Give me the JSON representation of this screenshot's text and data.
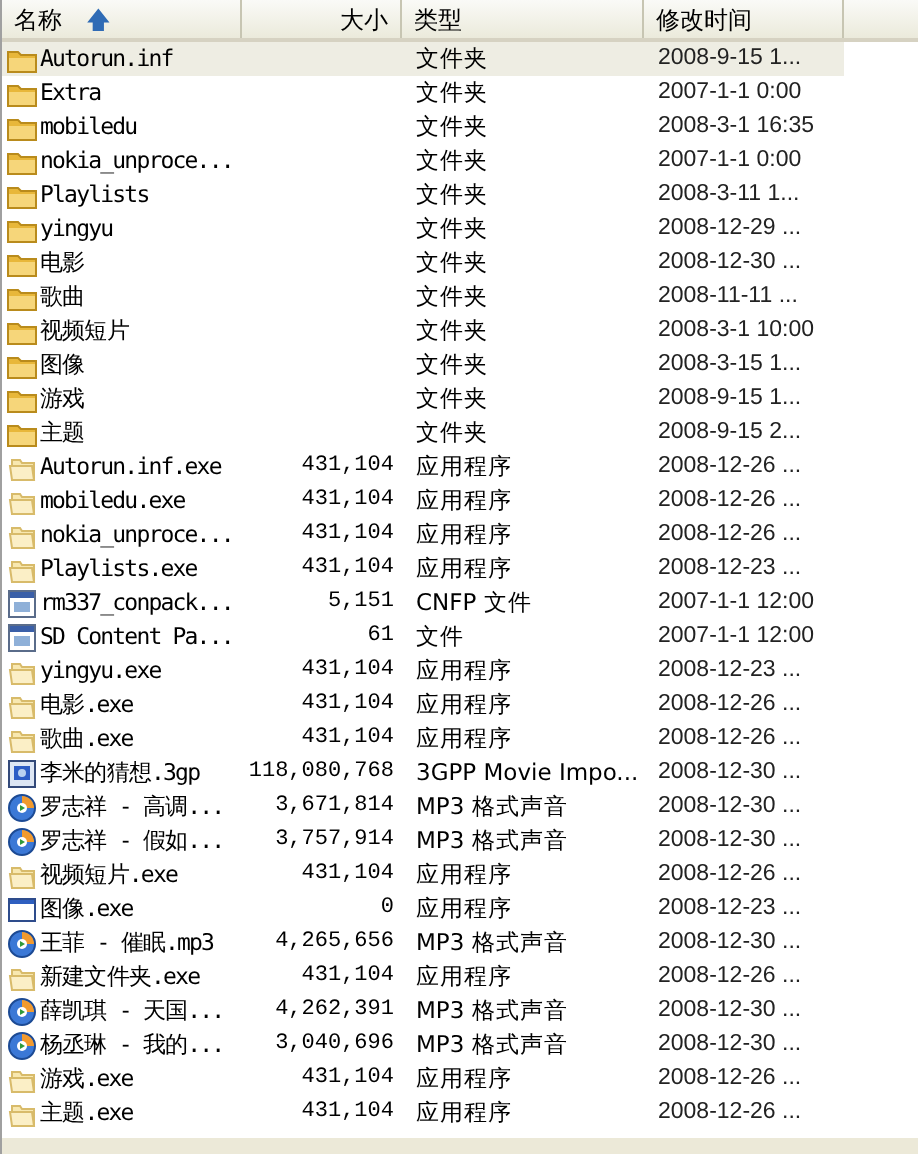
{
  "columns": [
    {
      "label": "名称",
      "sorted": true
    },
    {
      "label": "大小",
      "sorted": false
    },
    {
      "label": "类型",
      "sorted": false
    },
    {
      "label": "修改时间",
      "sorted": false
    }
  ],
  "sort_arrow": "🡅",
  "rows": [
    {
      "kind": "folder",
      "name": "Autorun.inf",
      "size": "",
      "type": "文件夹",
      "modified": "2008-9-15 1...",
      "selected": true
    },
    {
      "kind": "folder",
      "name": "Extra",
      "size": "",
      "type": "文件夹",
      "modified": "2007-1-1 0:00",
      "selected": false
    },
    {
      "kind": "folder",
      "name": "mobiledu",
      "size": "",
      "type": "文件夹",
      "modified": "2008-3-1 16:35",
      "selected": false
    },
    {
      "kind": "folder",
      "name": "nokia_unproce...",
      "size": "",
      "type": "文件夹",
      "modified": "2007-1-1 0:00",
      "selected": false
    },
    {
      "kind": "folder",
      "name": "Playlists",
      "size": "",
      "type": "文件夹",
      "modified": "2008-3-11 1...",
      "selected": false
    },
    {
      "kind": "folder",
      "name": "yingyu",
      "size": "",
      "type": "文件夹",
      "modified": "2008-12-29 ...",
      "selected": false
    },
    {
      "kind": "folder",
      "name": "电影",
      "size": "",
      "type": "文件夹",
      "modified": "2008-12-30 ...",
      "selected": false
    },
    {
      "kind": "folder",
      "name": "歌曲",
      "size": "",
      "type": "文件夹",
      "modified": "2008-11-11 ...",
      "selected": false
    },
    {
      "kind": "folder",
      "name": "视频短片",
      "size": "",
      "type": "文件夹",
      "modified": "2008-3-1 10:00",
      "selected": false
    },
    {
      "kind": "folder",
      "name": "图像",
      "size": "",
      "type": "文件夹",
      "modified": "2008-3-15 1...",
      "selected": false
    },
    {
      "kind": "folder",
      "name": "游戏",
      "size": "",
      "type": "文件夹",
      "modified": "2008-9-15 1...",
      "selected": false
    },
    {
      "kind": "folder",
      "name": "主题",
      "size": "",
      "type": "文件夹",
      "modified": "2008-9-15 2...",
      "selected": false
    },
    {
      "kind": "exe",
      "name": "Autorun.inf.exe",
      "size": "431,104",
      "type": "应用程序",
      "modified": "2008-12-26 ...",
      "selected": false
    },
    {
      "kind": "exe",
      "name": "mobiledu.exe",
      "size": "431,104",
      "type": "应用程序",
      "modified": "2008-12-26 ...",
      "selected": false
    },
    {
      "kind": "exe",
      "name": "nokia_unproce...",
      "size": "431,104",
      "type": "应用程序",
      "modified": "2008-12-26 ...",
      "selected": false
    },
    {
      "kind": "exe",
      "name": "Playlists.exe",
      "size": "431,104",
      "type": "应用程序",
      "modified": "2008-12-23 ...",
      "selected": false
    },
    {
      "kind": "file",
      "name": "rm337_conpack...",
      "size": "5,151",
      "type": "CNFP 文件",
      "modified": "2007-1-1 12:00",
      "selected": false
    },
    {
      "kind": "file",
      "name": "SD Content Pa...",
      "size": "61",
      "type": "文件",
      "modified": "2007-1-1 12:00",
      "selected": false
    },
    {
      "kind": "exe",
      "name": "yingyu.exe",
      "size": "431,104",
      "type": "应用程序",
      "modified": "2008-12-23 ...",
      "selected": false
    },
    {
      "kind": "exe",
      "name": "电影.exe",
      "size": "431,104",
      "type": "应用程序",
      "modified": "2008-12-26 ...",
      "selected": false
    },
    {
      "kind": "exe",
      "name": "歌曲.exe",
      "size": "431,104",
      "type": "应用程序",
      "modified": "2008-12-26 ...",
      "selected": false
    },
    {
      "kind": "video",
      "name": "李米的猜想.3gp",
      "size": "118,080,768",
      "type": "3GPP Movie Impo...",
      "modified": "2008-12-30 ...",
      "selected": false
    },
    {
      "kind": "audio",
      "name": "罗志祥 - 高调...",
      "size": "3,671,814",
      "type": "MP3 格式声音",
      "modified": "2008-12-30 ...",
      "selected": false
    },
    {
      "kind": "audio",
      "name": "罗志祥 - 假如...",
      "size": "3,757,914",
      "type": "MP3 格式声音",
      "modified": "2008-12-30 ...",
      "selected": false
    },
    {
      "kind": "exe",
      "name": "视频短片.exe",
      "size": "431,104",
      "type": "应用程序",
      "modified": "2008-12-26 ...",
      "selected": false
    },
    {
      "kind": "window",
      "name": "图像.exe",
      "size": "0",
      "type": "应用程序",
      "modified": "2008-12-23 ...",
      "selected": false
    },
    {
      "kind": "audio",
      "name": "王菲 - 催眠.mp3",
      "size": "4,265,656",
      "type": "MP3 格式声音",
      "modified": "2008-12-30 ...",
      "selected": false
    },
    {
      "kind": "exe",
      "name": "新建文件夹.exe",
      "size": "431,104",
      "type": "应用程序",
      "modified": "2008-12-26 ...",
      "selected": false
    },
    {
      "kind": "audio",
      "name": "薛凯琪 - 天国...",
      "size": "4,262,391",
      "type": "MP3 格式声音",
      "modified": "2008-12-30 ...",
      "selected": false
    },
    {
      "kind": "audio",
      "name": "杨丞琳 - 我的...",
      "size": "3,040,696",
      "type": "MP3 格式声音",
      "modified": "2008-12-30 ...",
      "selected": false
    },
    {
      "kind": "exe",
      "name": "游戏.exe",
      "size": "431,104",
      "type": "应用程序",
      "modified": "2008-12-26 ...",
      "selected": false
    },
    {
      "kind": "exe",
      "name": "主题.exe",
      "size": "431,104",
      "type": "应用程序",
      "modified": "2008-12-26 ...",
      "selected": false
    }
  ]
}
